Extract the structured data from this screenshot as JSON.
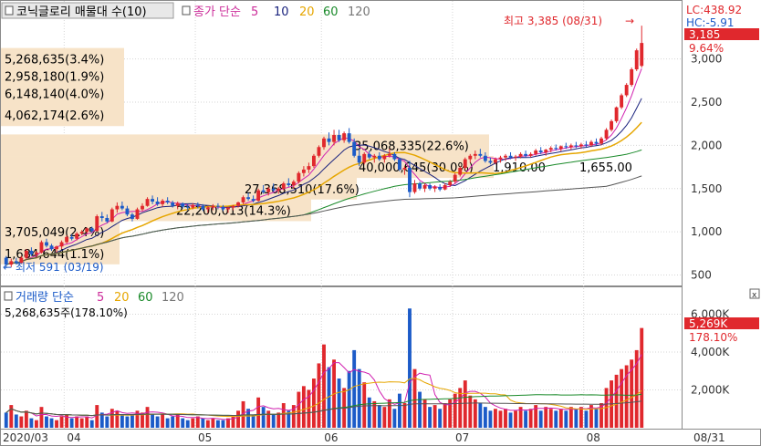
{
  "title": "코닉글로리 매물대 수(10)",
  "indicator_label": "종가 단순",
  "ma_periods": [
    "5",
    "10",
    "20",
    "60",
    "120"
  ],
  "volume_label": "거래량 단순",
  "volume_ma_periods": [
    "5",
    "20",
    "60",
    "120"
  ],
  "lc_label": "LC:438.92",
  "hc_label": "HC:-5.91",
  "current_price": "3,185",
  "current_change": "9.64%",
  "high_annotation": "최고 3,385 (08/31)",
  "low_annotation": "최저 591 (03/19)",
  "current_volume": "5,269K",
  "volume_change": "178.10%",
  "volume_header_value": "5,268,635주(178.10%)",
  "last_date": "08/31",
  "colors": {
    "up": "#e0282d",
    "down": "#1c5bc8",
    "band": "#f7e3c8",
    "ma5": "#d020b0",
    "ma10": "#1a237e",
    "ma20": "#e6a600",
    "ma60": "#1a8a2a",
    "ma120": "#555555"
  },
  "chart_data": [
    {
      "type": "candlestick",
      "title": "코닉글로리 매물대 수(10)",
      "x_tick_labels": [
        "2020/03",
        "04",
        "05",
        "06",
        "07",
        "08"
      ],
      "y_ticks": [
        500,
        1000,
        1500,
        2000,
        2500,
        3000
      ],
      "ylim": [
        400,
        3450
      ],
      "overlays": [
        "MA5",
        "MA10",
        "MA20",
        "MA60",
        "MA120"
      ],
      "volume_profile": [
        {
          "price": 3000,
          "label": "5,268,635(3.4%)"
        },
        {
          "price": 2800,
          "label": "2,958,180(1.9%)"
        },
        {
          "price": 2600,
          "label": "6,148,140(4.0%)"
        },
        {
          "price": 2350,
          "label": "4,062,174(2.6%)"
        },
        {
          "price": 2000,
          "label": "35,068,335(22.6%)"
        },
        {
          "price": 1750,
          "label": "40,000,645(30.0%)"
        },
        {
          "price": 1750,
          "label": "1,910.00"
        },
        {
          "price": 1750,
          "label": "1,655.00"
        },
        {
          "price": 1500,
          "label": "27,368,510(17.6%)"
        },
        {
          "price": 1250,
          "label": "22,200,013(14.3%)"
        },
        {
          "price": 1000,
          "label": "3,705,049(2.4%)"
        },
        {
          "price": 750,
          "label": "1,684,644(1.1%)"
        }
      ],
      "ohlc": [
        [
          700,
          720,
          580,
          620
        ],
        [
          620,
          690,
          591,
          660
        ],
        [
          660,
          700,
          620,
          640
        ],
        [
          640,
          720,
          630,
          700
        ],
        [
          700,
          800,
          680,
          780
        ],
        [
          780,
          820,
          720,
          740
        ],
        [
          740,
          780,
          700,
          760
        ],
        [
          760,
          900,
          750,
          880
        ],
        [
          880,
          920,
          820,
          840
        ],
        [
          840,
          860,
          780,
          800
        ],
        [
          800,
          840,
          760,
          830
        ],
        [
          830,
          900,
          800,
          880
        ],
        [
          880,
          960,
          860,
          940
        ],
        [
          940,
          970,
          900,
          920
        ],
        [
          920,
          1000,
          900,
          980
        ],
        [
          980,
          1020,
          960,
          1000
        ],
        [
          1000,
          1050,
          980,
          1040
        ],
        [
          1040,
          1060,
          990,
          1010
        ],
        [
          1010,
          1200,
          1000,
          1180
        ],
        [
          1180,
          1230,
          1120,
          1160
        ],
        [
          1160,
          1200,
          1100,
          1120
        ],
        [
          1120,
          1280,
          1110,
          1260
        ],
        [
          1260,
          1340,
          1220,
          1300
        ],
        [
          1300,
          1350,
          1250,
          1270
        ],
        [
          1270,
          1300,
          1180,
          1200
        ],
        [
          1200,
          1220,
          1120,
          1150
        ],
        [
          1150,
          1280,
          1140,
          1260
        ],
        [
          1260,
          1330,
          1240,
          1300
        ],
        [
          1300,
          1400,
          1290,
          1380
        ],
        [
          1380,
          1420,
          1320,
          1350
        ],
        [
          1350,
          1400,
          1300,
          1320
        ],
        [
          1320,
          1380,
          1290,
          1360
        ],
        [
          1360,
          1400,
          1320,
          1340
        ],
        [
          1340,
          1360,
          1280,
          1300
        ],
        [
          1300,
          1350,
          1260,
          1330
        ],
        [
          1330,
          1340,
          1270,
          1290
        ],
        [
          1290,
          1320,
          1250,
          1280
        ],
        [
          1280,
          1330,
          1260,
          1310
        ],
        [
          1310,
          1340,
          1270,
          1300
        ],
        [
          1300,
          1320,
          1240,
          1260
        ],
        [
          1260,
          1300,
          1220,
          1280
        ],
        [
          1280,
          1320,
          1250,
          1300
        ],
        [
          1300,
          1330,
          1260,
          1290
        ],
        [
          1290,
          1310,
          1240,
          1260
        ],
        [
          1260,
          1290,
          1220,
          1280
        ],
        [
          1280,
          1310,
          1250,
          1300
        ],
        [
          1300,
          1350,
          1280,
          1340
        ],
        [
          1340,
          1420,
          1320,
          1400
        ],
        [
          1400,
          1450,
          1360,
          1380
        ],
        [
          1380,
          1420,
          1340,
          1360
        ],
        [
          1360,
          1500,
          1350,
          1480
        ],
        [
          1480,
          1540,
          1440,
          1460
        ],
        [
          1460,
          1520,
          1420,
          1500
        ],
        [
          1500,
          1560,
          1460,
          1480
        ],
        [
          1480,
          1520,
          1440,
          1500
        ],
        [
          1500,
          1580,
          1480,
          1560
        ],
        [
          1560,
          1620,
          1520,
          1540
        ],
        [
          1540,
          1600,
          1500,
          1580
        ],
        [
          1580,
          1700,
          1560,
          1680
        ],
        [
          1680,
          1760,
          1640,
          1720
        ],
        [
          1720,
          1800,
          1680,
          1760
        ],
        [
          1760,
          1900,
          1740,
          1880
        ],
        [
          1880,
          2000,
          1860,
          1980
        ],
        [
          1980,
          2100,
          1950,
          2080
        ],
        [
          2080,
          2150,
          2000,
          2040
        ],
        [
          2040,
          2180,
          2000,
          2120
        ],
        [
          2120,
          2180,
          2040,
          2060
        ],
        [
          2060,
          2160,
          2030,
          2140
        ],
        [
          2140,
          2200,
          2020,
          2040
        ],
        [
          2040,
          2080,
          1860,
          1880
        ],
        [
          1880,
          1960,
          1760,
          1800
        ],
        [
          1800,
          1920,
          1780,
          1900
        ],
        [
          1900,
          1940,
          1840,
          1860
        ],
        [
          1860,
          1900,
          1800,
          1880
        ],
        [
          1880,
          1920,
          1820,
          1840
        ],
        [
          1840,
          1900,
          1800,
          1880
        ],
        [
          1880,
          1960,
          1860,
          1900
        ],
        [
          1900,
          1920,
          1820,
          1840
        ],
        [
          1840,
          1860,
          1700,
          1720
        ],
        [
          1720,
          1760,
          1660,
          1740
        ],
        [
          1740,
          1820,
          1400,
          1460
        ],
        [
          1460,
          1600,
          1440,
          1560
        ],
        [
          1560,
          1580,
          1480,
          1500
        ],
        [
          1500,
          1560,
          1460,
          1540
        ],
        [
          1540,
          1560,
          1480,
          1500
        ],
        [
          1500,
          1540,
          1460,
          1520
        ],
        [
          1520,
          1550,
          1470,
          1490
        ],
        [
          1490,
          1560,
          1480,
          1540
        ],
        [
          1540,
          1600,
          1520,
          1580
        ],
        [
          1580,
          1680,
          1560,
          1660
        ],
        [
          1660,
          1760,
          1640,
          1740
        ],
        [
          1740,
          1860,
          1720,
          1840
        ],
        [
          1840,
          1900,
          1800,
          1880
        ],
        [
          1880,
          1940,
          1840,
          1900
        ],
        [
          1900,
          1960,
          1860,
          1880
        ],
        [
          1880,
          1920,
          1800,
          1820
        ],
        [
          1820,
          1860,
          1780,
          1800
        ],
        [
          1800,
          1860,
          1780,
          1840
        ],
        [
          1840,
          1880,
          1800,
          1860
        ],
        [
          1860,
          1900,
          1820,
          1880
        ],
        [
          1880,
          1920,
          1840,
          1860
        ],
        [
          1860,
          1890,
          1820,
          1870
        ],
        [
          1870,
          1920,
          1850,
          1900
        ],
        [
          1900,
          1940,
          1860,
          1880
        ],
        [
          1880,
          1920,
          1860,
          1900
        ],
        [
          1900,
          1960,
          1880,
          1940
        ],
        [
          1940,
          1980,
          1900,
          1920
        ],
        [
          1920,
          1960,
          1880,
          1950
        ],
        [
          1950,
          1990,
          1920,
          1970
        ],
        [
          1970,
          2010,
          1940,
          1960
        ],
        [
          1960,
          2000,
          1930,
          1990
        ],
        [
          1990,
          2030,
          1960,
          1980
        ],
        [
          1980,
          2020,
          1950,
          2000
        ],
        [
          2000,
          2040,
          1970,
          1990
        ],
        [
          1990,
          2030,
          1960,
          2010
        ],
        [
          2010,
          2050,
          1980,
          2000
        ],
        [
          2000,
          2060,
          1980,
          2040
        ],
        [
          2040,
          2080,
          2000,
          2020
        ],
        [
          2020,
          2100,
          2000,
          2080
        ],
        [
          2080,
          2200,
          2060,
          2180
        ],
        [
          2180,
          2300,
          2160,
          2280
        ],
        [
          2280,
          2450,
          2260,
          2440
        ],
        [
          2440,
          2600,
          2420,
          2580
        ],
        [
          2580,
          2720,
          2560,
          2700
        ],
        [
          2700,
          2900,
          2680,
          2880
        ],
        [
          2880,
          3120,
          2860,
          3100
        ],
        [
          2920,
          3385,
          2900,
          3185
        ]
      ],
      "volume_ticks": [
        "2,000K",
        "4,000K",
        "6,000K"
      ],
      "volume_ylim": [
        0,
        6600
      ],
      "volume": [
        [
          800,
          "d"
        ],
        [
          1200,
          "u"
        ],
        [
          700,
          "d"
        ],
        [
          600,
          "u"
        ],
        [
          900,
          "u"
        ],
        [
          500,
          "d"
        ],
        [
          400,
          "u"
        ],
        [
          1100,
          "u"
        ],
        [
          600,
          "d"
        ],
        [
          500,
          "d"
        ],
        [
          400,
          "u"
        ],
        [
          600,
          "u"
        ],
        [
          700,
          "u"
        ],
        [
          500,
          "d"
        ],
        [
          600,
          "u"
        ],
        [
          500,
          "u"
        ],
        [
          600,
          "u"
        ],
        [
          400,
          "d"
        ],
        [
          1200,
          "u"
        ],
        [
          800,
          "d"
        ],
        [
          600,
          "d"
        ],
        [
          1000,
          "u"
        ],
        [
          900,
          "u"
        ],
        [
          700,
          "d"
        ],
        [
          600,
          "d"
        ],
        [
          700,
          "d"
        ],
        [
          900,
          "u"
        ],
        [
          800,
          "u"
        ],
        [
          1100,
          "u"
        ],
        [
          700,
          "d"
        ],
        [
          600,
          "d"
        ],
        [
          700,
          "u"
        ],
        [
          500,
          "d"
        ],
        [
          600,
          "d"
        ],
        [
          700,
          "u"
        ],
        [
          500,
          "d"
        ],
        [
          400,
          "d"
        ],
        [
          500,
          "u"
        ],
        [
          600,
          "u"
        ],
        [
          500,
          "d"
        ],
        [
          400,
          "u"
        ],
        [
          500,
          "u"
        ],
        [
          400,
          "d"
        ],
        [
          400,
          "d"
        ],
        [
          500,
          "u"
        ],
        [
          600,
          "u"
        ],
        [
          900,
          "u"
        ],
        [
          1400,
          "u"
        ],
        [
          1000,
          "d"
        ],
        [
          700,
          "d"
        ],
        [
          1600,
          "u"
        ],
        [
          1100,
          "d"
        ],
        [
          900,
          "u"
        ],
        [
          700,
          "d"
        ],
        [
          800,
          "u"
        ],
        [
          1300,
          "u"
        ],
        [
          900,
          "d"
        ],
        [
          1200,
          "u"
        ],
        [
          1900,
          "u"
        ],
        [
          2200,
          "u"
        ],
        [
          2000,
          "u"
        ],
        [
          2600,
          "u"
        ],
        [
          3400,
          "u"
        ],
        [
          4400,
          "u"
        ],
        [
          3200,
          "d"
        ],
        [
          3600,
          "u"
        ],
        [
          2600,
          "d"
        ],
        [
          2100,
          "u"
        ],
        [
          3000,
          "d"
        ],
        [
          4100,
          "d"
        ],
        [
          3100,
          "d"
        ],
        [
          2400,
          "u"
        ],
        [
          1600,
          "d"
        ],
        [
          1400,
          "u"
        ],
        [
          1200,
          "d"
        ],
        [
          1100,
          "u"
        ],
        [
          1500,
          "u"
        ],
        [
          1000,
          "d"
        ],
        [
          1800,
          "d"
        ],
        [
          1300,
          "u"
        ],
        [
          6300,
          "d"
        ],
        [
          3100,
          "u"
        ],
        [
          1900,
          "d"
        ],
        [
          1500,
          "u"
        ],
        [
          1100,
          "d"
        ],
        [
          1200,
          "u"
        ],
        [
          1000,
          "d"
        ],
        [
          1300,
          "u"
        ],
        [
          1500,
          "u"
        ],
        [
          1800,
          "u"
        ],
        [
          2100,
          "u"
        ],
        [
          2500,
          "u"
        ],
        [
          1700,
          "u"
        ],
        [
          1500,
          "u"
        ],
        [
          1300,
          "d"
        ],
        [
          1100,
          "d"
        ],
        [
          900,
          "d"
        ],
        [
          1000,
          "u"
        ],
        [
          900,
          "u"
        ],
        [
          1000,
          "u"
        ],
        [
          800,
          "d"
        ],
        [
          900,
          "u"
        ],
        [
          1100,
          "u"
        ],
        [
          900,
          "d"
        ],
        [
          1000,
          "u"
        ],
        [
          1200,
          "u"
        ],
        [
          900,
          "d"
        ],
        [
          1100,
          "u"
        ],
        [
          1000,
          "u"
        ],
        [
          900,
          "d"
        ],
        [
          1000,
          "u"
        ],
        [
          900,
          "d"
        ],
        [
          1100,
          "u"
        ],
        [
          1000,
          "d"
        ],
        [
          1100,
          "u"
        ],
        [
          900,
          "d"
        ],
        [
          1200,
          "u"
        ],
        [
          1000,
          "d"
        ],
        [
          1300,
          "u"
        ],
        [
          2100,
          "u"
        ],
        [
          2500,
          "u"
        ],
        [
          2800,
          "u"
        ],
        [
          3100,
          "u"
        ],
        [
          3300,
          "u"
        ],
        [
          3600,
          "u"
        ],
        [
          4100,
          "u"
        ],
        [
          5269,
          "u"
        ]
      ]
    }
  ]
}
